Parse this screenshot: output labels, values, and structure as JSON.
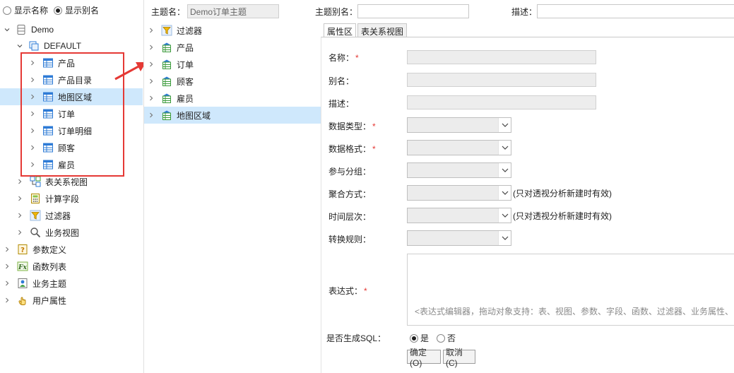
{
  "left_panel": {
    "radio": {
      "show_name": "显示名称",
      "show_alias": "显示别名",
      "selected": "show_alias"
    },
    "tree": {
      "root": "Demo",
      "default_schema": "DEFAULT",
      "tables": [
        "产品",
        "产品目录",
        "地图区域",
        "订单",
        "订单明细",
        "顾客",
        "雇员"
      ],
      "selected_table_index": 2,
      "schema_items": [
        "表关系视图",
        "计算字段",
        "过滤器",
        "业务视图"
      ],
      "root_items": [
        "参数定义",
        "函数列表",
        "业务主题",
        "用户属性"
      ]
    }
  },
  "middle_panel": {
    "topic_label": "主题名：",
    "topic_value": "Demo订单主题",
    "items": [
      "过滤器",
      "产品",
      "订单",
      "顾客",
      "雇员",
      "地图区域"
    ],
    "selected_index": 5
  },
  "right_panel": {
    "topic_alias_label": "主题别名：",
    "description_label": "描述：",
    "tabs": [
      "属性区",
      "表关系视图"
    ],
    "active_tab": 0,
    "fields": {
      "name": "名称：",
      "alias": "别名：",
      "description": "描述：",
      "data_type": "数据类型：",
      "data_format": "数据格式：",
      "group": "参与分组：",
      "aggregation": "聚合方式：",
      "time_level": "时间层次：",
      "transform_rule": "转换规则：",
      "expression": "表达式：",
      "generate_sql": "是否生成SQL："
    },
    "required_mark": "*",
    "pivot_hint": "(只对透视分析新建时有效)",
    "expression_placeholder": "<表达式编辑器，拖动对象支持：表、视图、参数、字段、函数、过滤器、业务属性、",
    "generate_sql_options": {
      "yes": "是",
      "no": "否",
      "selected": "yes"
    },
    "buttons": {
      "ok": "确定(O)",
      "cancel": "取消(C)"
    }
  },
  "colors": {
    "selection": "#cfe8fc",
    "highlight_red": "#e53935",
    "table_icon_blue": "#2e7bd6",
    "filter_icon_yellow": "#f2b705",
    "topic_icon_green": "#3a9a3a"
  }
}
